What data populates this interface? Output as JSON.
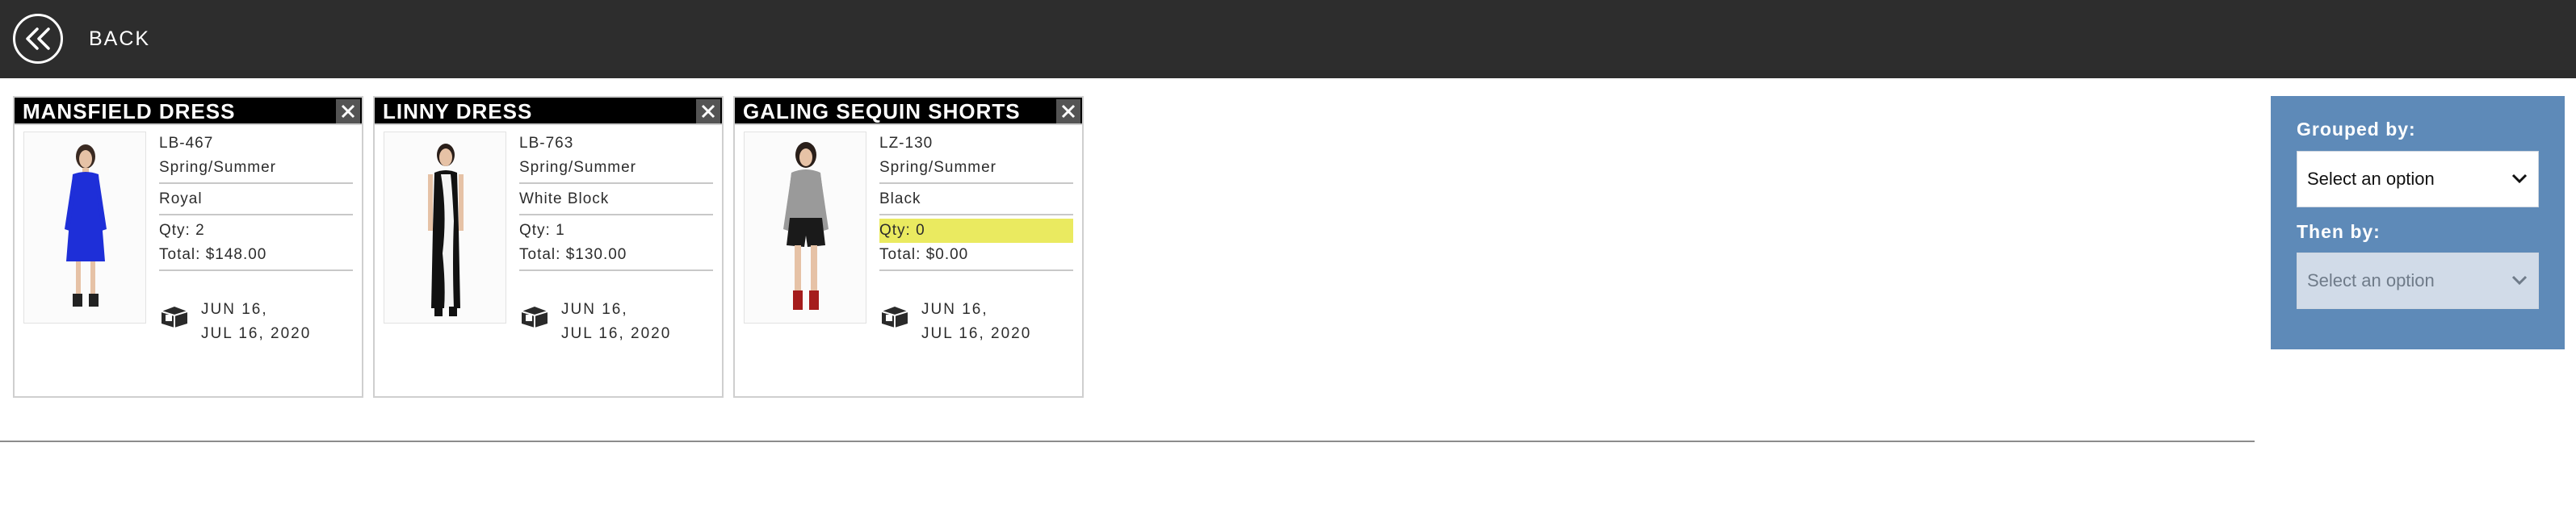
{
  "topbar": {
    "back_label": "BACK",
    "back_icon": "double-chevron-left-icon"
  },
  "cards": [
    {
      "title": "MANSFIELD DRESS",
      "sku": "LB-467",
      "season": "Spring/Summer",
      "color": "Royal",
      "qty": "Qty: 2",
      "total": "Total: $148.00",
      "ship_date_1": "JUN 16,",
      "ship_date_2": "JUL 16, 2020",
      "dress_color": "#1e2fd8",
      "qty_highlight": false
    },
    {
      "title": "LINNY DRESS",
      "sku": "LB-763",
      "season": "Spring/Summer",
      "color": "White Block",
      "qty": "Qty: 1",
      "total": "Total: $130.00",
      "ship_date_1": "JUN 16,",
      "ship_date_2": "JUL 16, 2020",
      "dress_color": "#111111",
      "qty_highlight": false
    },
    {
      "title": "GALING SEQUIN SHORTS",
      "sku": "LZ-130",
      "season": "Spring/Summer",
      "color": "Black",
      "qty": "Qty: 0",
      "total": "Total: $0.00",
      "ship_date_1": "JUN 16,",
      "ship_date_2": "JUL 16, 2020",
      "dress_color": "#2a2a2a",
      "qty_highlight": true
    }
  ],
  "sidebar": {
    "grouped_by_label": "Grouped by:",
    "grouped_by_value": "Select an option",
    "then_by_label": "Then by:",
    "then_by_value": "Select an option",
    "panel_color": "#5e8ab8"
  },
  "colors": {
    "topbar": "#2d2d2d",
    "highlight": "#eaea60"
  }
}
